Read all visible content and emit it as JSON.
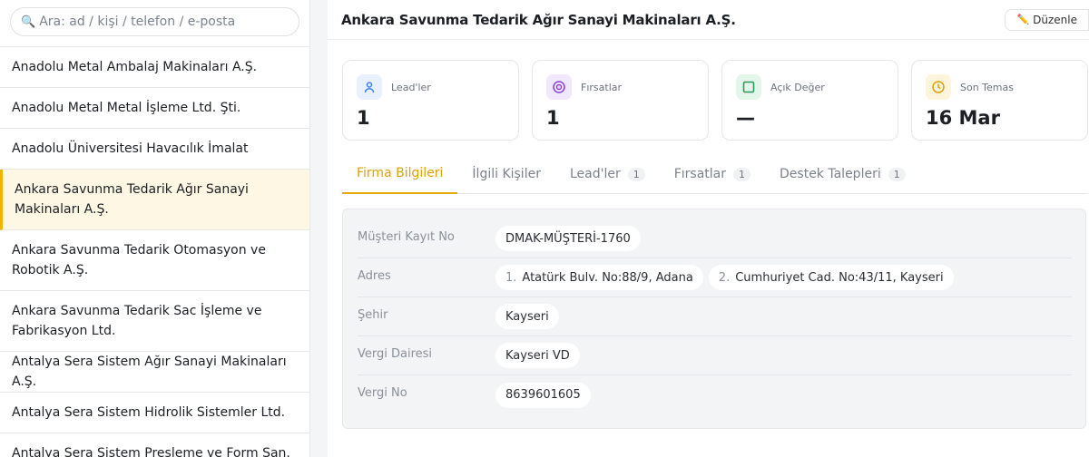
{
  "search": {
    "placeholder": "Ara: ad / kişi / telefon / e-posta",
    "icon": "search-icon"
  },
  "companies": [
    {
      "name": "Anadolu Metal Ambalaj Makinaları A.Ş."
    },
    {
      "name": "Anadolu Metal Metal İşleme Ltd. Şti."
    },
    {
      "name": "Anadolu Üniversitesi Havacılık İmalat"
    },
    {
      "name": "Ankara Savunma Tedarik Ağır Sanayi Makinaları A.Ş.",
      "active": true
    },
    {
      "name": "Ankara Savunma Tedarik Otomasyon ve Robotik A.Ş."
    },
    {
      "name": "Ankara Savunma Tedarik Sac İşleme ve Fabrikasyon Ltd."
    },
    {
      "name": "Antalya Sera Sistem Ağır Sanayi Makinaları A.Ş."
    },
    {
      "name": "Antalya Sera Sistem Hidrolik Sistemler Ltd."
    },
    {
      "name": "Antalya Sera Sistem Presleme ve Form San."
    }
  ],
  "header": {
    "title": "Ankara Savunma Tedarik Ağır Sanayi Makinaları A.Ş.",
    "edit_label": "Düzenle",
    "edit_icon": "pencil-icon"
  },
  "stats": [
    {
      "label": "Lead'ler",
      "value": "1",
      "icon": "user-icon",
      "color": "#3b82f6",
      "bg": "#e8f1fd"
    },
    {
      "label": "Fırsatlar",
      "value": "1",
      "icon": "target-icon",
      "color": "#8b3fd9",
      "bg": "#f1e8fb"
    },
    {
      "label": "Açık Değer",
      "value": "—",
      "icon": "square-icon",
      "color": "#1f9d55",
      "bg": "#e4f5ea"
    },
    {
      "label": "Son Temas",
      "value": "16 Mar",
      "icon": "clock-icon",
      "color": "#e0a100",
      "bg": "#fdf4dc"
    }
  ],
  "tabs": [
    {
      "label": "Firma Bilgileri",
      "active": true
    },
    {
      "label": "İlgili Kişiler"
    },
    {
      "label": "Lead'ler",
      "count": "1"
    },
    {
      "label": "Fırsatlar",
      "count": "1"
    },
    {
      "label": "Destek Talepleri",
      "count": "1"
    }
  ],
  "info": {
    "customer_no_label": "Müşteri Kayıt No",
    "customer_no": "DMAK-MÜŞTERİ-1760",
    "address_label": "Adres",
    "addresses": [
      {
        "num": "1.",
        "text": "Atatürk Bulv. No:88/9, Adana"
      },
      {
        "num": "2.",
        "text": "Cumhuriyet Cad. No:43/11, Kayseri"
      }
    ],
    "city_label": "Şehir",
    "city": "Kayseri",
    "tax_office_label": "Vergi Dairesi",
    "tax_office": "Kayseri VD",
    "tax_no_label": "Vergi No",
    "tax_no": "8639601605"
  },
  "colors": {
    "accent": "#e6a800",
    "active_bg": "#fdf7e4"
  }
}
